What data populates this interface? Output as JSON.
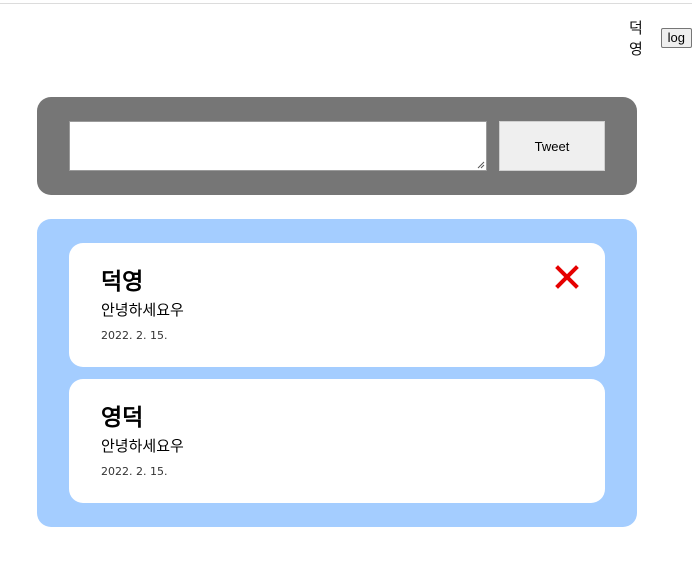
{
  "header": {
    "username": "덕영",
    "logout_label": "log"
  },
  "compose": {
    "text_value": "",
    "tweet_label": "Tweet"
  },
  "feed": {
    "tweets": [
      {
        "author": "덕영",
        "text": "안녕하세요우",
        "date": "2022. 2. 15.",
        "deletable": true
      },
      {
        "author": "영덕",
        "text": "안녕하세요우",
        "date": "2022. 2. 15.",
        "deletable": false
      }
    ]
  },
  "colors": {
    "compose_bg": "#767676",
    "feed_bg": "#a4cdff",
    "delete_red": "#e60000"
  },
  "icons": {
    "delete": "close-icon",
    "resize": "resize-grip-icon"
  }
}
